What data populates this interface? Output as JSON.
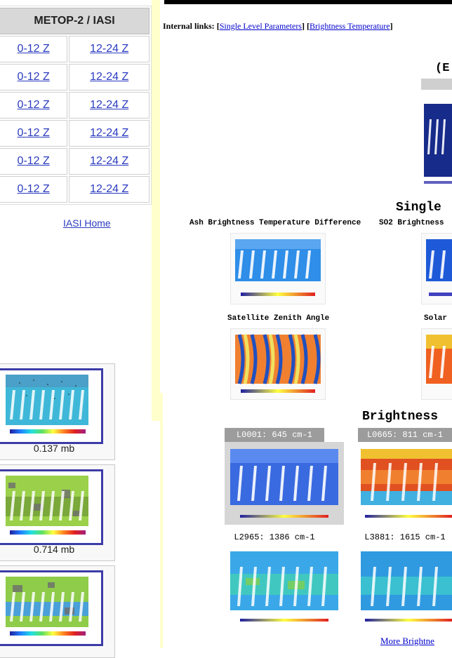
{
  "sidebar": {
    "table_header": "METOP-2 / IASI",
    "rows": [
      {
        "left": "0-12 Z",
        "right": "12-24 Z"
      },
      {
        "left": "0-12 Z",
        "right": "12-24 Z"
      },
      {
        "left": "0-12 Z",
        "right": "12-24 Z"
      },
      {
        "left": "0-12 Z",
        "right": "12-24 Z"
      },
      {
        "left": "0-12 Z",
        "right": "12-24 Z"
      },
      {
        "left": "0-12 Z",
        "right": "12-24 Z"
      }
    ],
    "home_link": "IASI Home",
    "thumbnails": [
      {
        "caption": "0.137 mb"
      },
      {
        "caption": "0.714 mb"
      }
    ]
  },
  "main": {
    "internal_links_label": "Internal links:",
    "links": [
      "Single Level Parameters",
      "Brightness Temperature"
    ],
    "top_heading_partial": "(E",
    "single_heading": "Single",
    "single_panels": [
      {
        "label": "Ash Brightness Temperature Difference"
      },
      {
        "label": "SO2 Brightness"
      },
      {
        "label": "Satellite Zenith Angle"
      },
      {
        "label": "Solar"
      }
    ],
    "bt_heading": "Brightness",
    "bt_panels": [
      {
        "label": "L0001: 645 cm-1"
      },
      {
        "label": "L0665: 811 cm-1"
      },
      {
        "label": "L2965: 1386 cm-1"
      },
      {
        "label": "L3881: 1615 cm-1"
      }
    ],
    "more_link": "More Brightne"
  },
  "colors": {
    "accent_yellow": "#ffffcc",
    "link_blue": "#0000cc",
    "frame_blue": "#3c3ca8",
    "label_gray": "#9c9c9c"
  }
}
